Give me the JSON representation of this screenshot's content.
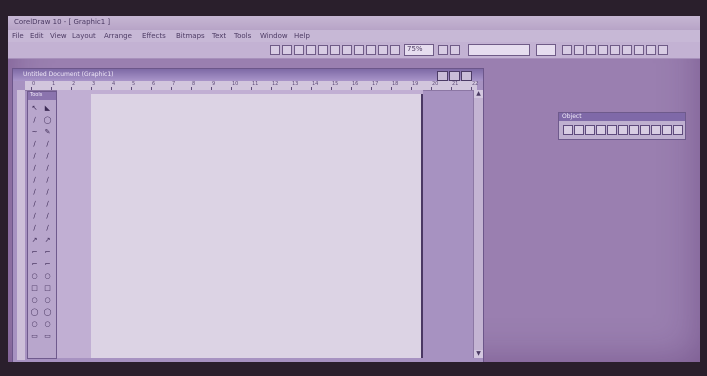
{
  "app": {
    "title": "CorelDraw 10 - [ Graphic1 ]"
  },
  "menu": [
    "File",
    "Edit",
    "View",
    "Layout",
    "Arrange",
    "Effects",
    "Bitmaps",
    "Text",
    "Tools",
    "Window",
    "Help"
  ],
  "toolbar": {
    "zoom_value": "75%",
    "font_value": ""
  },
  "document": {
    "title": "Untitled Document (Graphic1)"
  },
  "ruler": {
    "labels": [
      "0",
      "1",
      "2",
      "3",
      "4",
      "5",
      "6",
      "7",
      "8",
      "9",
      "10",
      "11",
      "12",
      "13",
      "14",
      "15",
      "16",
      "17",
      "18",
      "19",
      "20",
      "21",
      "22"
    ]
  },
  "toolbox": {
    "title": "Tools"
  },
  "palette": {
    "title": "Object"
  }
}
